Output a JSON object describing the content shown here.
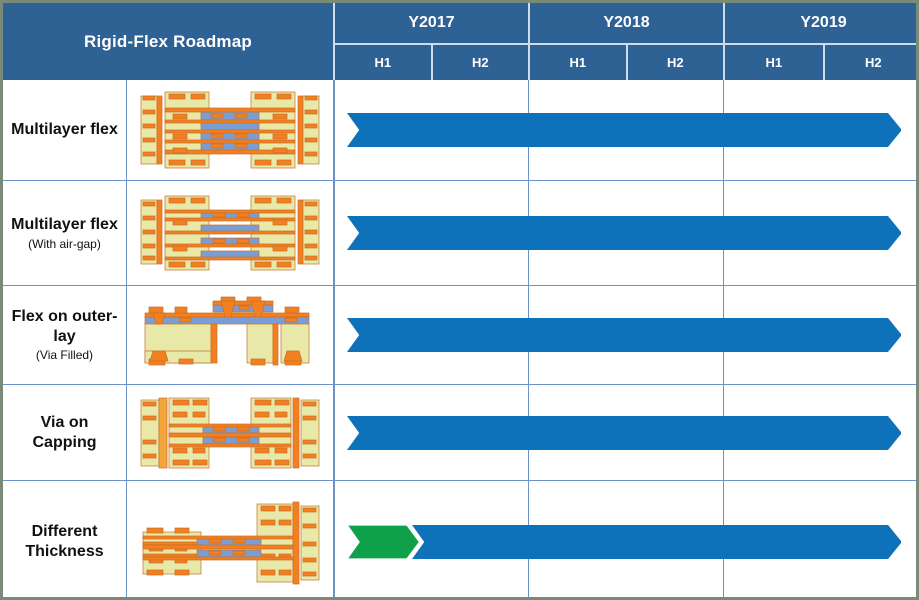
{
  "header": {
    "title": "Rigid-Flex Roadmap",
    "years": [
      {
        "label": "Y2017",
        "halves": [
          "H1",
          "H2"
        ]
      },
      {
        "label": "Y2018",
        "halves": [
          "H1",
          "H2"
        ]
      },
      {
        "label": "Y2019",
        "halves": [
          "H1",
          "H2"
        ]
      }
    ]
  },
  "colors": {
    "header_blue": "#2e6194",
    "arrow_blue": "#0d72b9",
    "arrow_green": "#0fa04a",
    "grid_blue": "#6b93c9",
    "outer_border": "#7a8a78",
    "dielectric": "#e8e8a8",
    "copper": "#f28020",
    "flex_core": "#7a9ed4"
  },
  "rows": [
    {
      "label": "Multilayer flex",
      "label_main": "Multilayer flex",
      "label_sub": "",
      "figure": "multilayer-flex-cross-section",
      "bars": [
        {
          "color": "blue",
          "start_label": "Y2017 H1",
          "end_label": "Y2019 H2",
          "start_pct": 2.0,
          "end_pct": 97.5
        }
      ]
    },
    {
      "label": "Multilayer flex (With air-gap)",
      "label_main": "Multilayer flex",
      "label_sub": "(With air-gap)",
      "figure": "multilayer-flex-airgap-cross-section",
      "bars": [
        {
          "color": "blue",
          "start_label": "Y2017 H1",
          "end_label": "Y2019 H2",
          "start_pct": 2.0,
          "end_pct": 97.5
        }
      ]
    },
    {
      "label": "Flex on outer-lay (Via Filled)",
      "label_main": "Flex on outer-lay",
      "label_sub": "(Via Filled)",
      "figure": "flex-on-outer-layer-cross-section",
      "bars": [
        {
          "color": "blue",
          "start_label": "Y2017 H1",
          "end_label": "Y2019 H2",
          "start_pct": 2.0,
          "end_pct": 97.5
        }
      ]
    },
    {
      "label": "Via on Capping",
      "label_main": "Via on Capping",
      "label_sub": "",
      "figure": "via-on-capping-cross-section",
      "bars": [
        {
          "color": "blue",
          "start_label": "Y2017 H1",
          "end_label": "Y2019 H2",
          "start_pct": 2.0,
          "end_pct": 97.5
        }
      ]
    },
    {
      "label": "Different Thickness",
      "label_main": "Different Thickness",
      "label_sub": "",
      "figure": "different-thickness-cross-section",
      "bars": [
        {
          "color": "green",
          "start_label": "Y2017 H1",
          "end_label": "Y2017 H1",
          "start_pct": 2.0,
          "end_pct": 14.5
        },
        {
          "color": "blue",
          "start_label": "Y2017 H1",
          "end_label": "Y2019 H2",
          "start_pct": 13.2,
          "end_pct": 97.5
        }
      ]
    }
  ]
}
